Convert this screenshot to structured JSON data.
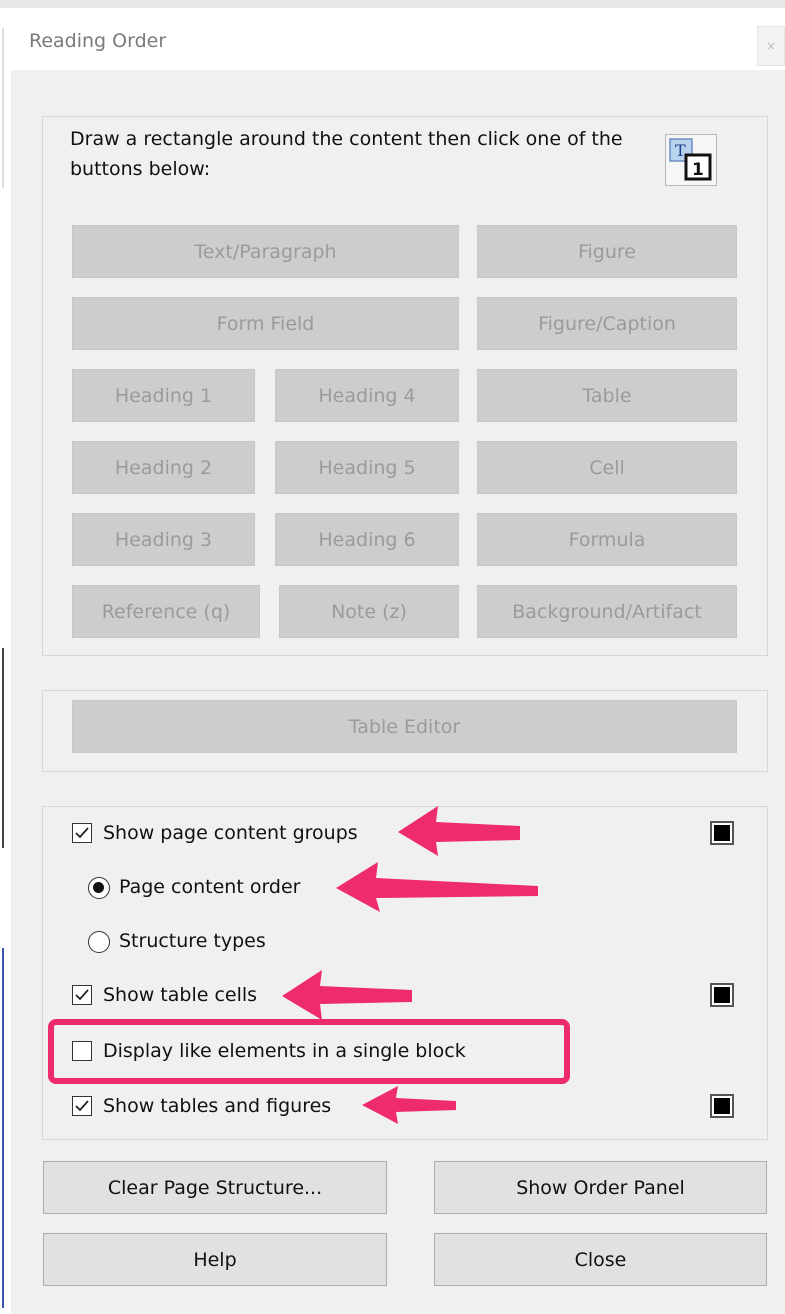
{
  "dialog": {
    "title": "Reading Order",
    "close_glyph": "×"
  },
  "tag_panel": {
    "instruction": "Draw a rectangle around the content then click one of the buttons below:",
    "icon": "reading-order-tag-icon",
    "icon_letter": "T",
    "icon_number": "1",
    "buttons": {
      "text_paragraph": "Text/Paragraph",
      "figure": "Figure",
      "form_field": "Form Field",
      "figure_caption": "Figure/Caption",
      "heading1": "Heading 1",
      "heading4": "Heading 4",
      "table": "Table",
      "heading2": "Heading 2",
      "heading5": "Heading 5",
      "cell": "Cell",
      "heading3": "Heading 3",
      "heading6": "Heading 6",
      "formula": "Formula",
      "reference": "Reference (q)",
      "note": "Note (z)",
      "background_artifact": "Background/Artifact"
    }
  },
  "table_editor": {
    "label": "Table Editor"
  },
  "options": {
    "show_page_content_groups": {
      "label": "Show page content groups",
      "checked": true
    },
    "page_content_order": {
      "label": "Page content order",
      "selected": true
    },
    "structure_types": {
      "label": "Structure types",
      "selected": false
    },
    "show_table_cells": {
      "label": "Show table cells",
      "checked": true
    },
    "display_like_elements": {
      "label": "Display like elements in a single block",
      "checked": false
    },
    "show_tables_and_figures": {
      "label": "Show tables and figures",
      "checked": true
    },
    "swatch_color": "#000000"
  },
  "footer": {
    "clear_page_structure": "Clear Page Structure...",
    "show_order_panel": "Show Order Panel",
    "help": "Help",
    "close": "Close"
  },
  "annotation_color": "#ee2b6c"
}
